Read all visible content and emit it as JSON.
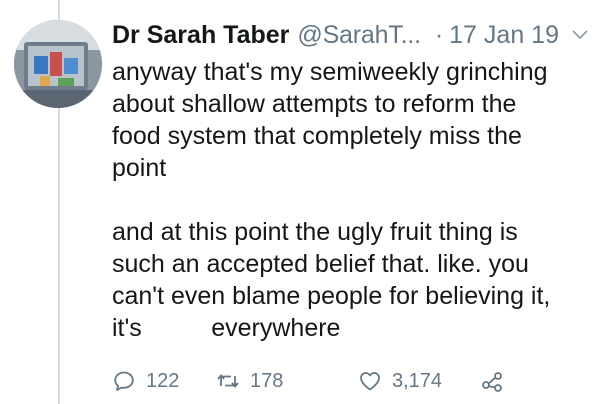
{
  "tweet": {
    "display_name": "Dr Sarah Taber",
    "handle": "@SarahT...",
    "separator": "·",
    "date": "17 Jan 19",
    "paragraphs": [
      "anyway that's my semiweekly grinching\nabout shallow attempts to reform the\nfood system that completely miss the\npoint",
      "and at this point the ugly fruit thing is\nsuch an accepted belief that. like. you\ncan't even blame people for believing it,\nit's          everywhere"
    ]
  },
  "actions": {
    "reply_count": "122",
    "retweet_count": "178",
    "like_count": "3,174"
  },
  "icons": {
    "reply": "reply-icon",
    "retweet": "retweet-icon",
    "like": "heart-icon",
    "share": "share-icon",
    "caret": "chevron-down-icon"
  },
  "colors": {
    "text": "#14171a",
    "secondary": "#657786",
    "thread_line": "#d4dadf"
  }
}
